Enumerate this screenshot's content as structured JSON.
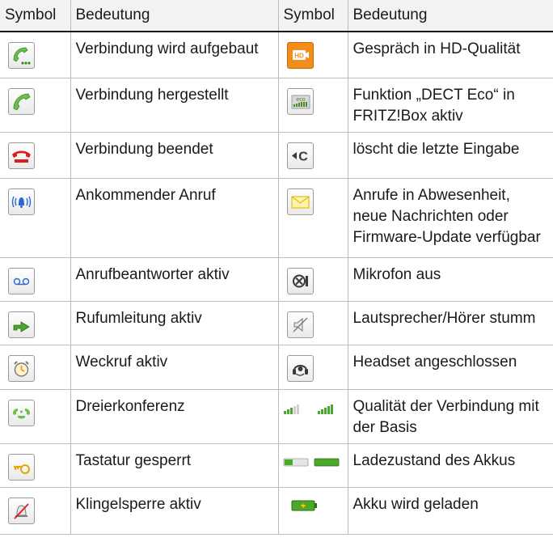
{
  "header": {
    "col1": "Symbol",
    "col2": "Bedeutung",
    "col3": "Symbol",
    "col4": "Bedeutung"
  },
  "rows": [
    {
      "left_icon": "connecting-phone-icon",
      "left_text": "Verbindung wird aufgebaut",
      "right_icon": "hd-quality-icon",
      "right_text": "Gespräch in HD-Qualität"
    },
    {
      "left_icon": "green-phone-icon",
      "left_text": "Verbindung hergestellt",
      "right_icon": "dect-eco-icon",
      "right_text": "Funktion „DECT Eco“ in FRITZ!Box aktiv",
      "right_icon_text": "eco"
    },
    {
      "left_icon": "red-phone-icon",
      "left_text": "Verbindung beendet",
      "right_icon": "delete-c-icon",
      "right_text": "löscht die letzte Eingabe",
      "right_icon_text": "C"
    },
    {
      "left_icon": "ringing-bell-icon",
      "left_text": "Ankommender Anruf",
      "right_icon": "envelope-icon",
      "right_text": "Anrufe in Abwesenheit, neue Nachrichten oder Firmware-Update verfügbar"
    },
    {
      "left_icon": "voicemail-icon",
      "left_text": "Anrufbeantworter aktiv",
      "right_icon": "microphone-off-icon",
      "right_text": "Mikrofon aus"
    },
    {
      "left_icon": "call-forward-arrow-icon",
      "left_text": "Rufumleitung aktiv",
      "right_icon": "speaker-muted-icon",
      "right_text": "Lautsprecher/Hörer stumm"
    },
    {
      "left_icon": "alarm-clock-icon",
      "left_text": "Weckruf aktiv",
      "right_icon": "headset-icon",
      "right_text": "Headset angeschlossen"
    },
    {
      "left_icon": "conference-icon",
      "left_text": "Dreierkonferenz",
      "right_icon": "signal-bars-icon",
      "right_text": "Qualität der Verbindung mit der Basis"
    },
    {
      "left_icon": "key-icon",
      "left_text": "Tastatur gesperrt",
      "right_icon": "battery-level-icon",
      "right_text": "Ladezustand des Akkus"
    },
    {
      "left_icon": "bell-muted-icon",
      "left_text": "Klingelsperre aktiv",
      "right_icon": "battery-charging-icon",
      "right_text": "Akku wird geladen"
    }
  ],
  "colors": {
    "green": "#6cc04a",
    "red": "#d81e1e",
    "orange": "#f28c1a",
    "blue": "#2a66d8",
    "header_bg": "#f2f2f2"
  }
}
